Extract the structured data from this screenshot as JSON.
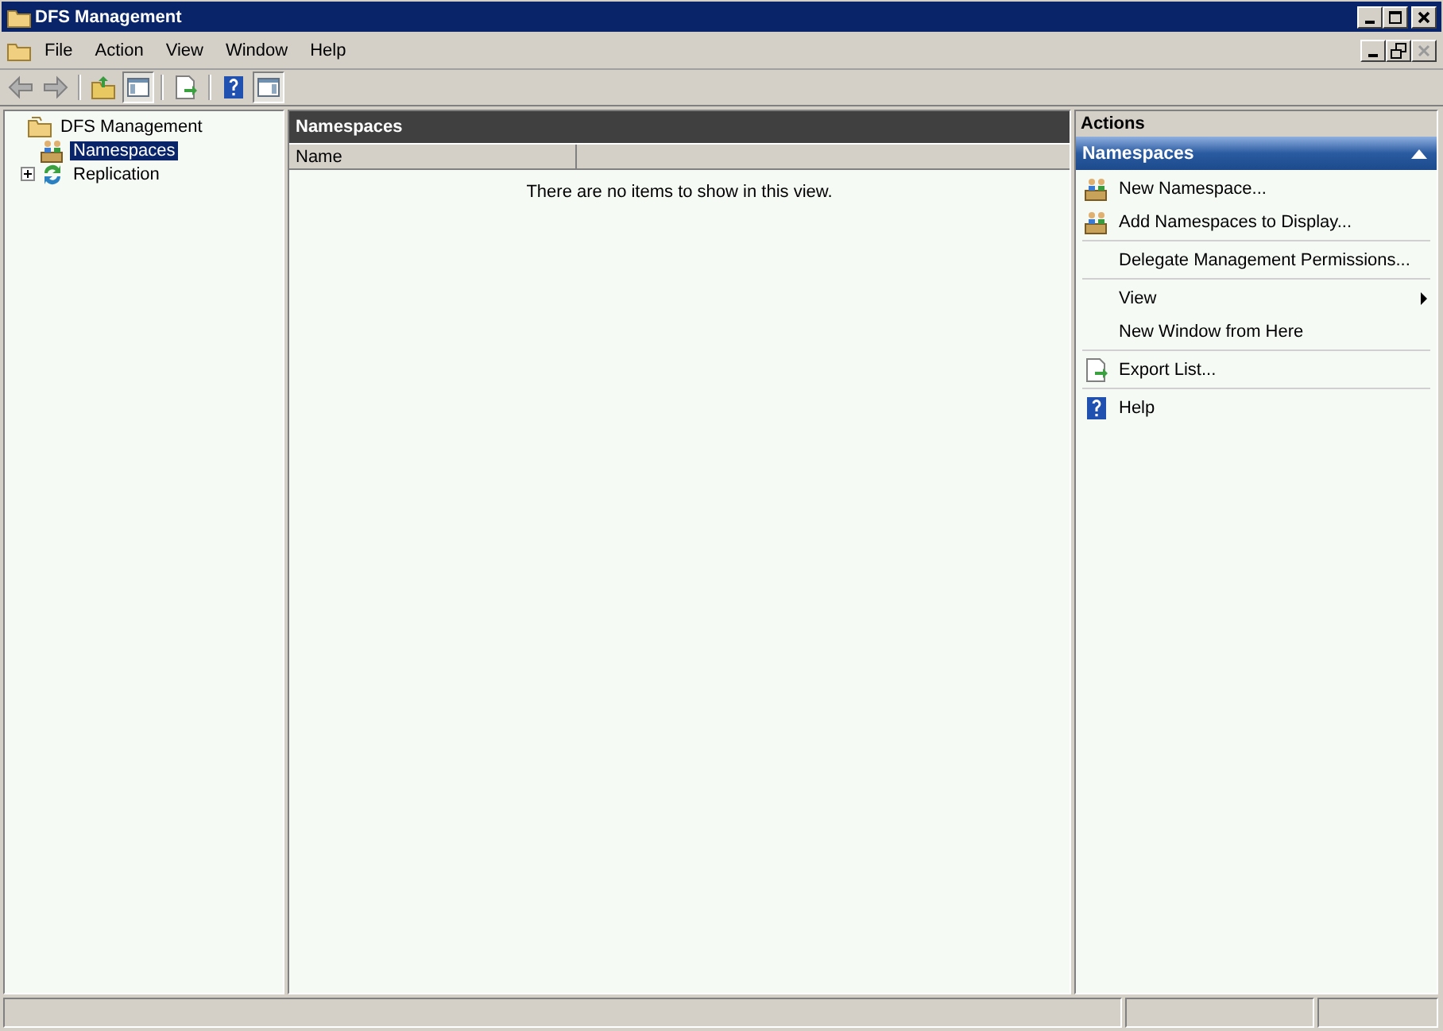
{
  "window": {
    "title": "DFS Management"
  },
  "menu": [
    "File",
    "Action",
    "View",
    "Window",
    "Help"
  ],
  "tree": [
    {
      "label": "DFS Management",
      "kind": "root",
      "selected": false,
      "children": [
        {
          "label": "Namespaces",
          "kind": "namespace",
          "selected": true
        },
        {
          "label": "Replication",
          "kind": "replication",
          "selected": false,
          "expanded": false
        }
      ]
    }
  ],
  "center": {
    "title": "Namespaces",
    "columns": [
      "Name"
    ],
    "empty_message": "There are no items to show in this view."
  },
  "actions": {
    "title": "Actions",
    "section": {
      "title": "Namespaces",
      "expanded": true
    },
    "groups": [
      [
        {
          "label": "New Namespace...",
          "kind": "namespace"
        },
        {
          "label": "Add Namespaces to Display...",
          "kind": "namespace"
        }
      ],
      [
        {
          "label": "Delegate Management Permissions...",
          "kind": "plain"
        }
      ],
      [
        {
          "label": "View",
          "kind": "submenu"
        },
        {
          "label": "New Window from Here",
          "kind": "plain"
        }
      ],
      [
        {
          "label": "Export List...",
          "kind": "export"
        }
      ],
      [
        {
          "label": "Help",
          "kind": "help"
        }
      ]
    ]
  }
}
